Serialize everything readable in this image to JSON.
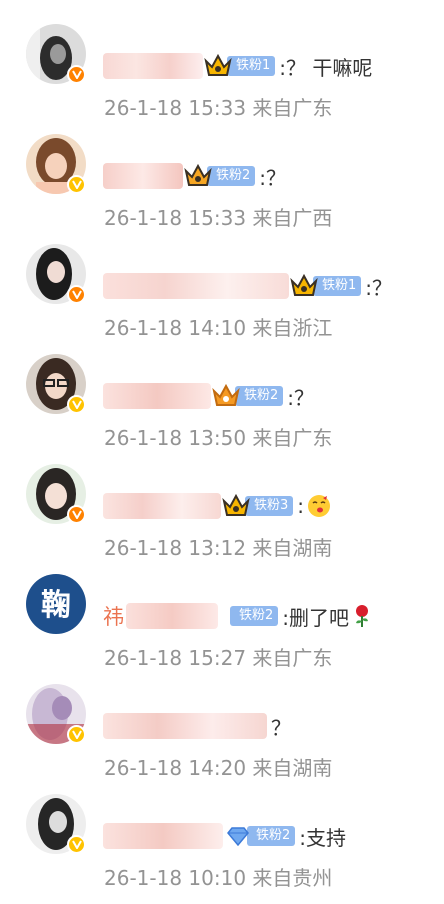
{
  "colors": {
    "name_orange": "#eb7350",
    "meta_gray": "#939393",
    "fan_badge_blue": "#8fb8ef",
    "vip_orange": "#ff8200",
    "vip_yellow": "#ffc300"
  },
  "comments": [
    {
      "badge_level": "铁粉1",
      "badge_icon": "crown-icon",
      "text": ":？ 干嘛呢",
      "time": "26-1-18 15:33",
      "location": "来自广东",
      "verify": "orange"
    },
    {
      "badge_level": "铁粉2",
      "badge_icon": "crown-icon",
      "text": ":？",
      "time": "26-1-18 15:33",
      "location": "来自广西",
      "verify": "yellow"
    },
    {
      "badge_level": "铁粉1",
      "badge_icon": "crown-icon",
      "text": ":？",
      "time": "26-1-18 14:10",
      "location": "来自浙江",
      "verify": "orange"
    },
    {
      "badge_level": "铁粉2",
      "badge_icon": "crown-icon",
      "text": ":？",
      "time": "26-1-18 13:50",
      "location": "来自广东",
      "verify": "yellow"
    },
    {
      "badge_level": "铁粉3",
      "badge_icon": "crown-icon",
      "text": ":",
      "emoji": "kiss-face-emoji",
      "time": "26-1-18 13:12",
      "location": "来自湖南",
      "verify": "orange"
    },
    {
      "name_prefix": "祎",
      "badge_level": "铁粉2",
      "badge_icon": "",
      "text": ":删了吧",
      "emoji": "rose-emoji",
      "time": "26-1-18 15:27",
      "location": "来自广东",
      "verify": ""
    },
    {
      "badge_level": "",
      "badge_icon": "",
      "text": "？",
      "time": "26-1-18 14:20",
      "location": "来自湖南",
      "verify": "yellow"
    },
    {
      "badge_level": "铁粉2",
      "badge_icon": "diamond-icon",
      "text": ":支持",
      "time": "26-1-18 10:10",
      "location": "来自贵州",
      "verify": "yellow"
    }
  ]
}
